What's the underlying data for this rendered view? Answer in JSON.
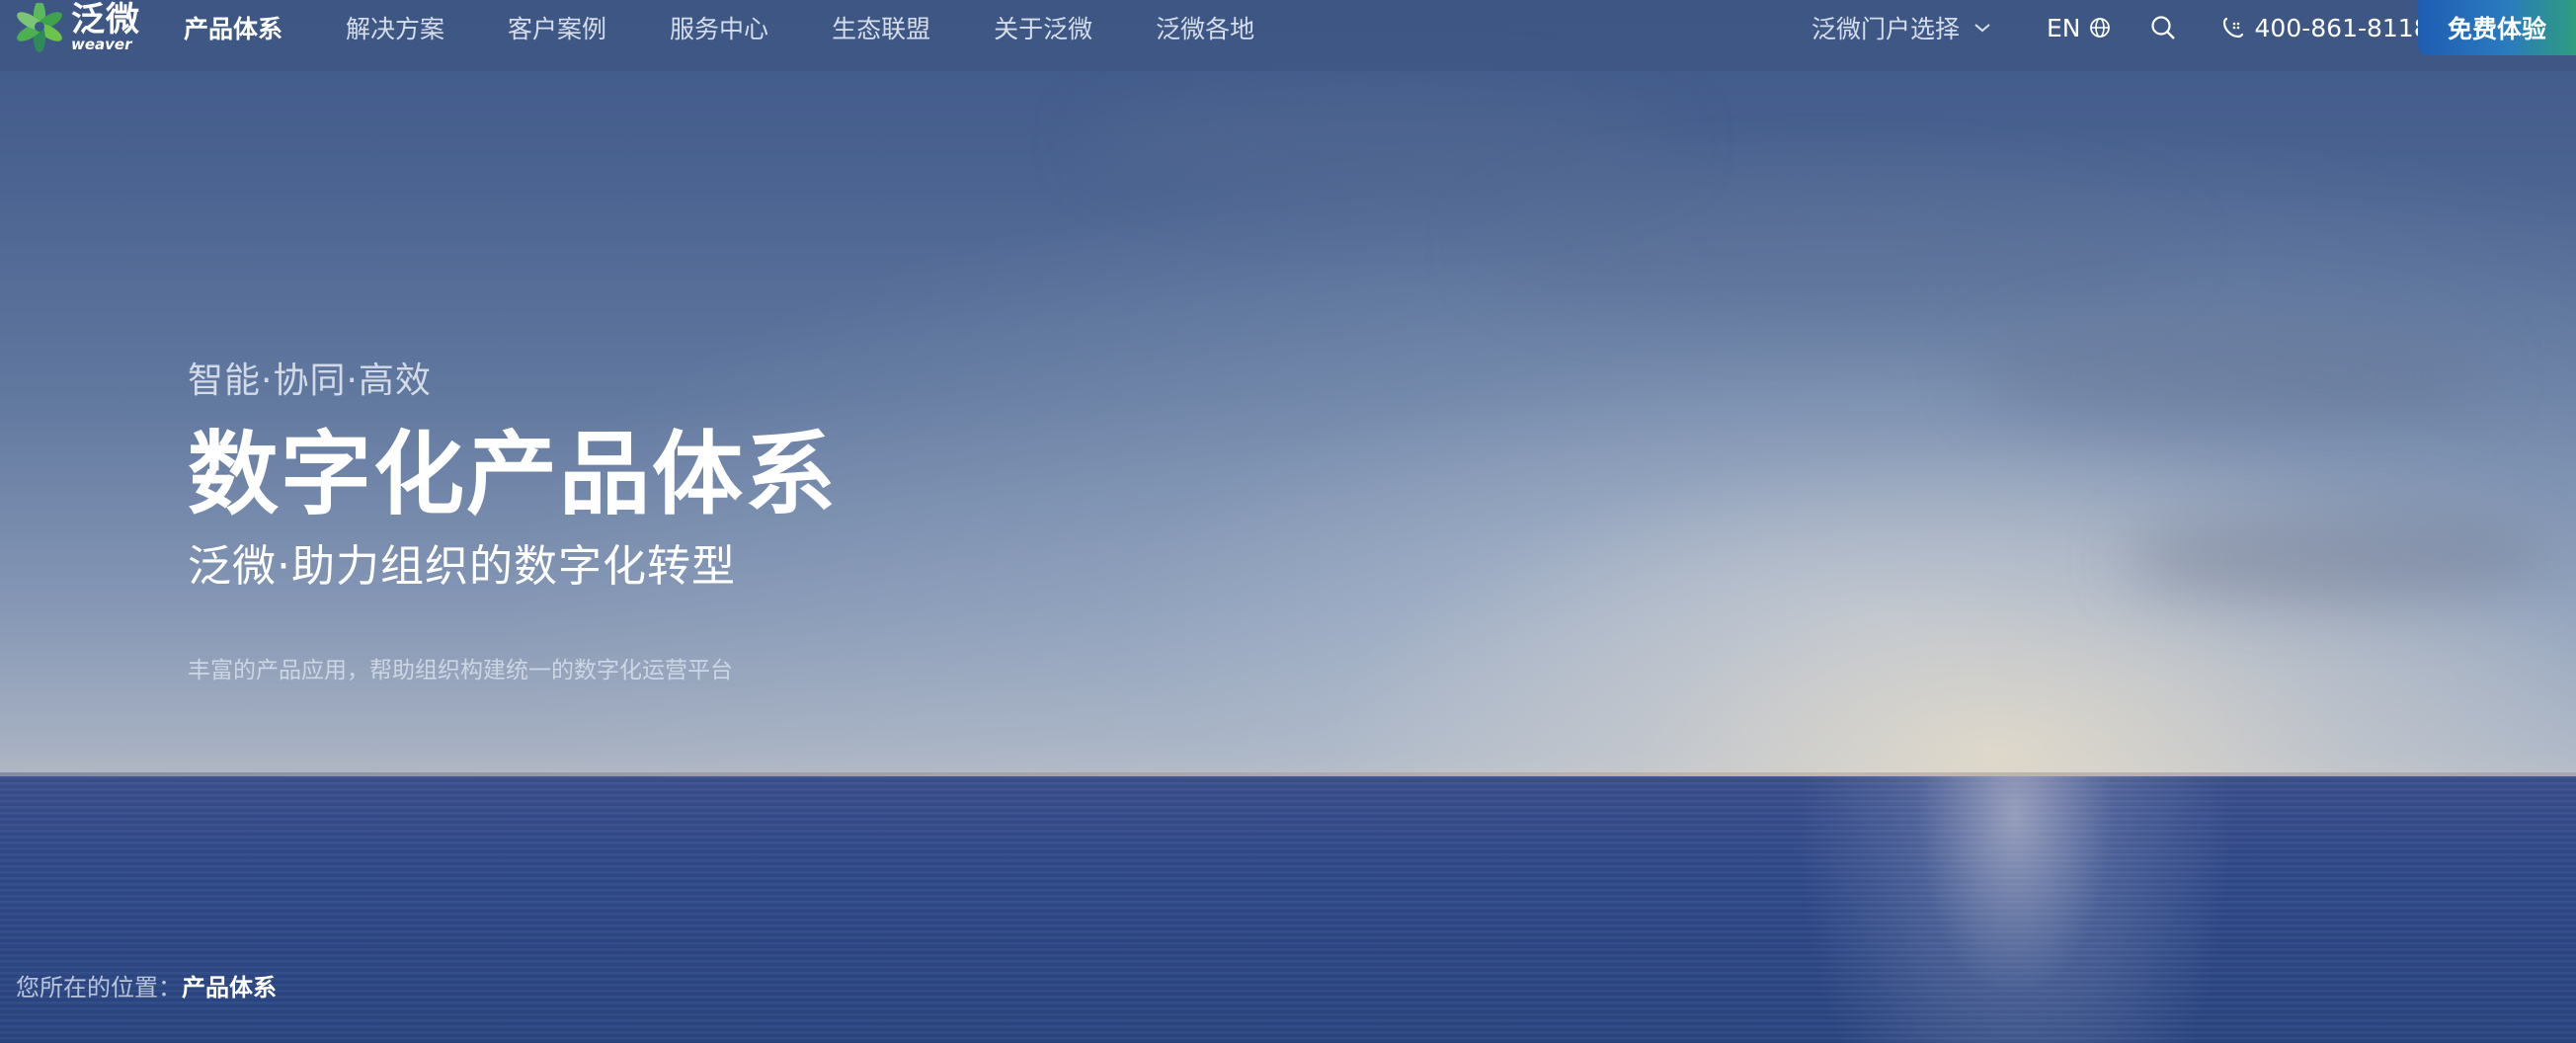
{
  "brand": {
    "name_cn": "泛微",
    "name_en": "weaver"
  },
  "nav": {
    "items": [
      {
        "label": "产品体系",
        "active": true
      },
      {
        "label": "解决方案",
        "active": false
      },
      {
        "label": "客户案例",
        "active": false
      },
      {
        "label": "服务中心",
        "active": false
      },
      {
        "label": "生态联盟",
        "active": false
      },
      {
        "label": "关于泛微",
        "active": false
      },
      {
        "label": "泛微各地",
        "active": false
      }
    ],
    "portal_label": "泛微门户选择",
    "lang_label": "EN",
    "phone": "400-861-8118",
    "trial_label": "免费体验"
  },
  "hero": {
    "tagline": "智能·协同·高效",
    "title": "数字化产品体系",
    "subtitle": "泛微·助力组织的数字化转型",
    "description": "丰富的产品应用，帮助组织构建统一的数字化运营平台"
  },
  "breadcrumb": {
    "prefix": "您所在的位置：",
    "current": "产品体系"
  },
  "colors": {
    "brand_green": "#4caf50",
    "trial_gradient_start": "#1f5db2",
    "trial_gradient_end": "#2f9d7e"
  },
  "icons": [
    "weaver-logo-icon",
    "chevron-down-icon",
    "globe-icon",
    "search-icon",
    "phone-icon"
  ]
}
